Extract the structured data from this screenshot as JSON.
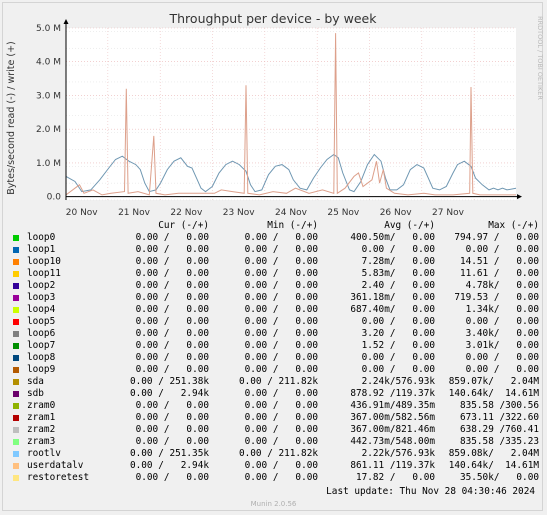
{
  "chart_data": {
    "type": "line",
    "title": "Throughput per device - by week",
    "ylabel": "Bytes/second read (-) / write (+)",
    "watermark": "RRDTOOL / TOBI OETIKER",
    "ylim": [
      -0.1,
      5.0
    ],
    "yunit": "M",
    "yticks": [
      0.0,
      1.0,
      2.0,
      3.0,
      4.0,
      5.0
    ],
    "ytick_labels": [
      "0.0",
      "1.0 M",
      "2.0 M",
      "3.0 M",
      "4.0 M",
      "5.0 M"
    ],
    "x_categories": [
      "20 Nov",
      "21 Nov",
      "22 Nov",
      "23 Nov",
      "24 Nov",
      "25 Nov",
      "26 Nov",
      "27 Nov"
    ],
    "grid": true,
    "colors": {
      "background": "#ffffff",
      "grid_major": "#e9b5b5",
      "grid_minor": "#dddddd",
      "axis": "#000000"
    },
    "series": [
      {
        "name": "sdb",
        "color": "#6f97b2",
        "points": [
          [
            0.0,
            0.6
          ],
          [
            0.2,
            0.45
          ],
          [
            0.35,
            0.15
          ],
          [
            0.55,
            0.2
          ],
          [
            0.75,
            0.5
          ],
          [
            0.95,
            0.85
          ],
          [
            1.1,
            1.1
          ],
          [
            1.25,
            1.2
          ],
          [
            1.4,
            1.05
          ],
          [
            1.55,
            0.95
          ],
          [
            1.65,
            0.8
          ],
          [
            1.75,
            0.4
          ],
          [
            1.85,
            0.15
          ],
          [
            2.0,
            0.2
          ],
          [
            2.1,
            0.4
          ],
          [
            2.25,
            0.8
          ],
          [
            2.4,
            1.05
          ],
          [
            2.55,
            1.15
          ],
          [
            2.7,
            0.9
          ],
          [
            2.8,
            0.85
          ],
          [
            2.9,
            0.55
          ],
          [
            3.0,
            0.25
          ],
          [
            3.1,
            0.15
          ],
          [
            3.25,
            0.3
          ],
          [
            3.4,
            0.7
          ],
          [
            3.55,
            0.95
          ],
          [
            3.7,
            1.05
          ],
          [
            3.85,
            0.95
          ],
          [
            4.0,
            0.75
          ],
          [
            4.1,
            0.35
          ],
          [
            4.2,
            0.15
          ],
          [
            4.35,
            0.2
          ],
          [
            4.5,
            0.65
          ],
          [
            4.65,
            0.9
          ],
          [
            4.8,
            0.95
          ],
          [
            4.95,
            0.8
          ],
          [
            5.05,
            0.5
          ],
          [
            5.2,
            0.25
          ],
          [
            5.35,
            0.2
          ],
          [
            5.5,
            0.55
          ],
          [
            5.65,
            0.85
          ],
          [
            5.8,
            1.1
          ],
          [
            5.95,
            1.25
          ],
          [
            6.05,
            1.15
          ],
          [
            6.15,
            0.7
          ],
          [
            6.3,
            0.2
          ],
          [
            6.4,
            0.15
          ],
          [
            6.55,
            0.45
          ],
          [
            6.7,
            0.95
          ],
          [
            6.85,
            1.25
          ],
          [
            7.0,
            1.05
          ],
          [
            7.1,
            0.55
          ],
          [
            7.2,
            0.2
          ],
          [
            7.35,
            0.2
          ],
          [
            7.5,
            0.35
          ],
          [
            7.65,
            0.8
          ],
          [
            7.8,
            0.95
          ],
          [
            7.95,
            0.85
          ],
          [
            8.05,
            0.55
          ],
          [
            8.15,
            0.25
          ],
          [
            8.3,
            0.2
          ],
          [
            8.45,
            0.3
          ],
          [
            8.6,
            0.7
          ],
          [
            8.7,
            0.95
          ],
          [
            8.85,
            1.05
          ],
          [
            9.0,
            0.9
          ],
          [
            9.1,
            0.55
          ],
          [
            9.25,
            0.35
          ],
          [
            9.4,
            0.2
          ],
          [
            9.5,
            0.25
          ],
          [
            9.6,
            0.2
          ],
          [
            9.7,
            0.25
          ],
          [
            9.8,
            0.2
          ],
          [
            10.0,
            0.25
          ]
        ]
      },
      {
        "name": "sda",
        "color": "#dda08b",
        "points": [
          [
            0.0,
            0.05
          ],
          [
            0.3,
            0.35
          ],
          [
            0.4,
            0.1
          ],
          [
            0.6,
            0.2
          ],
          [
            0.8,
            0.05
          ],
          [
            1.0,
            0.1
          ],
          [
            1.3,
            0.15
          ],
          [
            1.34,
            3.2
          ],
          [
            1.38,
            0.1
          ],
          [
            1.6,
            0.15
          ],
          [
            1.85,
            0.05
          ],
          [
            1.95,
            1.8
          ],
          [
            2.0,
            0.1
          ],
          [
            2.2,
            0.05
          ],
          [
            2.5,
            0.1
          ],
          [
            3.0,
            0.1
          ],
          [
            3.3,
            0.1
          ],
          [
            3.45,
            0.2
          ],
          [
            3.7,
            0.15
          ],
          [
            3.96,
            0.1
          ],
          [
            4.0,
            3.3
          ],
          [
            4.04,
            0.1
          ],
          [
            4.3,
            0.05
          ],
          [
            4.6,
            0.15
          ],
          [
            4.9,
            0.1
          ],
          [
            5.1,
            0.25
          ],
          [
            5.4,
            0.1
          ],
          [
            5.7,
            0.2
          ],
          [
            5.95,
            0.1
          ],
          [
            5.99,
            4.85
          ],
          [
            6.03,
            0.1
          ],
          [
            6.2,
            0.25
          ],
          [
            6.4,
            0.6
          ],
          [
            6.5,
            0.7
          ],
          [
            6.6,
            0.3
          ],
          [
            6.8,
            0.5
          ],
          [
            6.9,
            1.05
          ],
          [
            6.97,
            0.4
          ],
          [
            7.05,
            0.8
          ],
          [
            7.12,
            0.25
          ],
          [
            7.3,
            0.1
          ],
          [
            7.6,
            0.05
          ],
          [
            7.95,
            0.1
          ],
          [
            8.2,
            0.05
          ],
          [
            8.6,
            0.05
          ],
          [
            8.97,
            0.1
          ],
          [
            9.0,
            3.25
          ],
          [
            9.04,
            0.1
          ],
          [
            9.2,
            0.05
          ],
          [
            9.6,
            0.05
          ],
          [
            10.0,
            0.05
          ]
        ]
      }
    ]
  },
  "legend": {
    "headers": {
      "cur": "Cur (-/+)",
      "min": "Min (-/+)",
      "avg": "Avg (-/+)",
      "max": "Max (-/+)"
    },
    "rows": [
      {
        "name": "loop0",
        "color": "#00cc00",
        "cur": "0.00 /   0.00",
        "min": "0.00 /   0.00",
        "avg": "400.50m/   0.00",
        "max": "794.97 /   0.00"
      },
      {
        "name": "loop1",
        "color": "#0066b3",
        "cur": "0.00 /   0.00",
        "min": "0.00 /   0.00",
        "avg": "0.00 /   0.00",
        "max": "0.00 /   0.00"
      },
      {
        "name": "loop10",
        "color": "#ff8000",
        "cur": "0.00 /   0.00",
        "min": "0.00 /   0.00",
        "avg": "7.28m/   0.00",
        "max": "14.51 /   0.00"
      },
      {
        "name": "loop11",
        "color": "#ffcc00",
        "cur": "0.00 /   0.00",
        "min": "0.00 /   0.00",
        "avg": "5.83m/   0.00",
        "max": "11.61 /   0.00"
      },
      {
        "name": "loop2",
        "color": "#330099",
        "cur": "0.00 /   0.00",
        "min": "0.00 /   0.00",
        "avg": "2.40 /   0.00",
        "max": "4.78k/   0.00"
      },
      {
        "name": "loop3",
        "color": "#990099",
        "cur": "0.00 /   0.00",
        "min": "0.00 /   0.00",
        "avg": "361.18m/   0.00",
        "max": "719.53 /   0.00"
      },
      {
        "name": "loop4",
        "color": "#ccff00",
        "cur": "0.00 /   0.00",
        "min": "0.00 /   0.00",
        "avg": "687.40m/   0.00",
        "max": "1.34k/   0.00"
      },
      {
        "name": "loop5",
        "color": "#ff0000",
        "cur": "0.00 /   0.00",
        "min": "0.00 /   0.00",
        "avg": "0.00 /   0.00",
        "max": "0.00 /   0.00"
      },
      {
        "name": "loop6",
        "color": "#808080",
        "cur": "0.00 /   0.00",
        "min": "0.00 /   0.00",
        "avg": "3.20 /   0.00",
        "max": "3.40k/   0.00"
      },
      {
        "name": "loop7",
        "color": "#008f00",
        "cur": "0.00 /   0.00",
        "min": "0.00 /   0.00",
        "avg": "1.52 /   0.00",
        "max": "3.01k/   0.00"
      },
      {
        "name": "loop8",
        "color": "#00487d",
        "cur": "0.00 /   0.00",
        "min": "0.00 /   0.00",
        "avg": "0.00 /   0.00",
        "max": "0.00 /   0.00"
      },
      {
        "name": "loop9",
        "color": "#b35a00",
        "cur": "0.00 /   0.00",
        "min": "0.00 /   0.00",
        "avg": "0.00 /   0.00",
        "max": "0.00 /   0.00"
      },
      {
        "name": "sda",
        "color": "#b38f00",
        "cur": "0.00 / 251.38k",
        "min": "0.00 / 211.82k",
        "avg": "2.24k/576.93k",
        "max": "859.07k/   2.04M"
      },
      {
        "name": "sdb",
        "color": "#6b006b",
        "cur": "0.00 /   2.94k",
        "min": "0.00 /   0.00",
        "avg": "878.92 /119.37k",
        "max": "140.64k/  14.61M"
      },
      {
        "name": "zram0",
        "color": "#8fb300",
        "cur": "0.00 /   0.00",
        "min": "0.00 /   0.00",
        "avg": "436.91m/489.35m",
        "max": "835.58 /300.56"
      },
      {
        "name": "zram1",
        "color": "#b30000",
        "cur": "0.00 /   0.00",
        "min": "0.00 /   0.00",
        "avg": "367.00m/582.56m",
        "max": "673.11 /322.60"
      },
      {
        "name": "zram2",
        "color": "#bebebe",
        "cur": "0.00 /   0.00",
        "min": "0.00 /   0.00",
        "avg": "367.00m/821.46m",
        "max": "638.29 /760.41"
      },
      {
        "name": "zram3",
        "color": "#80ff80",
        "cur": "0.00 /   0.00",
        "min": "0.00 /   0.00",
        "avg": "442.73m/548.00m",
        "max": "835.58 /335.23"
      },
      {
        "name": "rootlv",
        "color": "#80c9ff",
        "cur": "0.00 / 251.35k",
        "min": "0.00 / 211.82k",
        "avg": "2.22k/576.93k",
        "max": "859.08k/   2.04M"
      },
      {
        "name": "userdatalv",
        "color": "#ffc080",
        "cur": "0.00 /   2.94k",
        "min": "0.00 /   0.00",
        "avg": "861.11 /119.37k",
        "max": "140.64k/  14.61M"
      },
      {
        "name": "restoretest",
        "color": "#ffe680",
        "cur": "0.00 /   0.00",
        "min": "0.00 /   0.00",
        "avg": "17.82 /   0.00",
        "max": "35.50k/   0.00"
      }
    ]
  },
  "footer": {
    "last_update": "Last update: Thu Nov 28 04:30:46 2024",
    "version": "Munin 2.0.56"
  }
}
